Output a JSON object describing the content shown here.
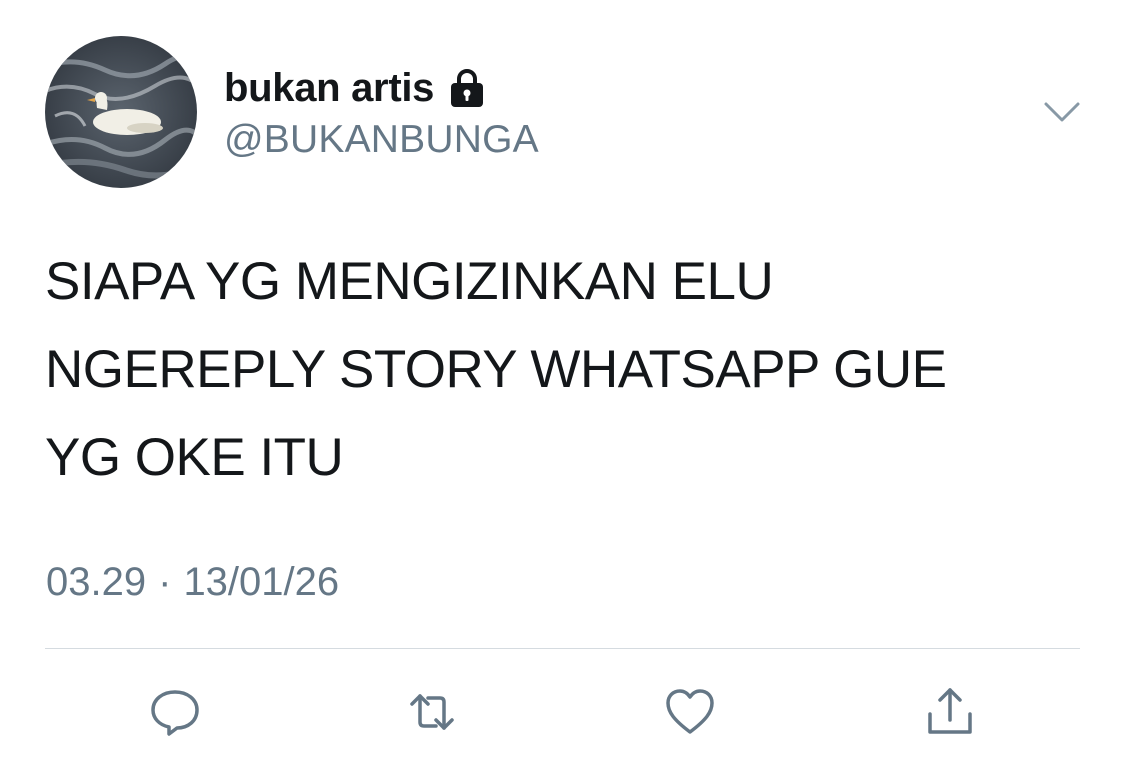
{
  "tweet": {
    "display_name": "bukan artis",
    "handle": "@BUKANBUNGA",
    "text": "SIAPA YG MENGIZINKAN ELU\nNGEREPLY STORY WHATSAPP GUE\nYG OKE ITU",
    "time": "03.29",
    "separator": "·",
    "date": "13/01/26"
  },
  "icons": {
    "lock": "lock-icon",
    "more": "chevron-down-icon",
    "reply": "reply-icon",
    "retweet": "retweet-icon",
    "like": "heart-icon",
    "share": "share-icon"
  },
  "colors": {
    "text": "#14171a",
    "secondary": "#657786",
    "divider": "#d5dbe0",
    "icon": "#657786"
  }
}
